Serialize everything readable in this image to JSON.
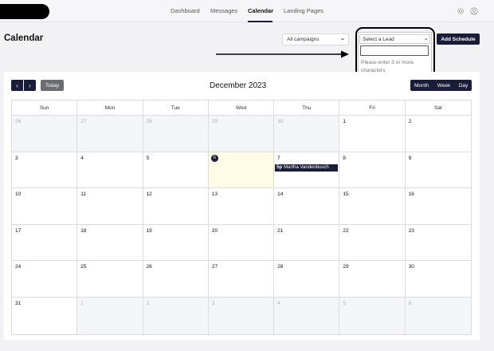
{
  "nav": {
    "links": [
      {
        "label": "Dashboard",
        "active": false
      },
      {
        "label": "Messages",
        "active": false
      },
      {
        "label": "Calendar",
        "active": true
      },
      {
        "label": "Landing Pages",
        "active": false
      }
    ],
    "icons": [
      "gear-icon",
      "user-icon"
    ]
  },
  "page": {
    "title": "Calendar"
  },
  "filters": {
    "campaign_value": "All campaigns",
    "lead_placeholder": "Select a Lead",
    "lead_search_value": "",
    "lead_hint": "Please enter 3 or more characters",
    "add_schedule_label": "Add Schedule"
  },
  "calendar": {
    "prev_label": "‹",
    "next_label": "›",
    "today_label": "Today",
    "month_label": "December 2023",
    "views": [
      "Month",
      "Week",
      "Day"
    ],
    "weekdays": [
      "Sun",
      "Mon",
      "Tue",
      "Wed",
      "Thu",
      "Fri",
      "Sat"
    ],
    "weeks": [
      [
        {
          "d": "26",
          "other": true
        },
        {
          "d": "27",
          "other": true
        },
        {
          "d": "28",
          "other": true
        },
        {
          "d": "29",
          "other": true
        },
        {
          "d": "30",
          "other": true
        },
        {
          "d": "1"
        },
        {
          "d": "2"
        }
      ],
      [
        {
          "d": "3"
        },
        {
          "d": "4"
        },
        {
          "d": "5"
        },
        {
          "d": "6",
          "today": true
        },
        {
          "d": "7",
          "event": {
            "time": "5p",
            "title": "Martha Vandenbusch"
          }
        },
        {
          "d": "8"
        },
        {
          "d": "9"
        }
      ],
      [
        {
          "d": "10"
        },
        {
          "d": "11"
        },
        {
          "d": "12"
        },
        {
          "d": "13"
        },
        {
          "d": "14"
        },
        {
          "d": "15"
        },
        {
          "d": "16"
        }
      ],
      [
        {
          "d": "17"
        },
        {
          "d": "18"
        },
        {
          "d": "19"
        },
        {
          "d": "20"
        },
        {
          "d": "21"
        },
        {
          "d": "22"
        },
        {
          "d": "23"
        }
      ],
      [
        {
          "d": "24"
        },
        {
          "d": "25"
        },
        {
          "d": "26"
        },
        {
          "d": "27"
        },
        {
          "d": "28"
        },
        {
          "d": "29"
        },
        {
          "d": "30"
        }
      ],
      [
        {
          "d": "31"
        },
        {
          "d": "1",
          "other": true
        },
        {
          "d": "2",
          "other": true
        },
        {
          "d": "3",
          "other": true
        },
        {
          "d": "4",
          "other": true
        },
        {
          "d": "5",
          "other": true
        },
        {
          "d": "6",
          "other": true
        }
      ]
    ]
  },
  "colors": {
    "primary": "#1b1b3a",
    "today_bg": "#fefce6",
    "other_month_bg": "#f4f5f8"
  }
}
